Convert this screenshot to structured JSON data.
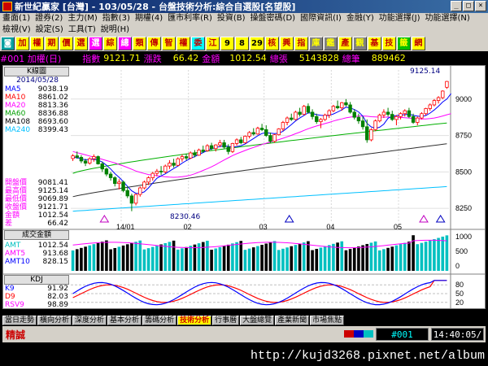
{
  "window": {
    "title": "新世紀贏家 [台灣] - 103/05/28 - 台盤技術分析:綜合自選股[名望股]"
  },
  "menu1": [
    "畫面(1)",
    "證券(2)",
    "主力(M)",
    "指數(3)",
    "期權(4)",
    "匯市利率(R)",
    "投資(B)",
    "操盤密碼(D)",
    "國際資訊(I)",
    "金融(Y)",
    "功能選擇(J)",
    "功能選擇(N)"
  ],
  "menu2": [
    "檢視(V)",
    "設定(S)",
    "工具(T)",
    "說明(H)"
  ],
  "toolbar": [
    {
      "label": "◙",
      "bg": "#00a0a0",
      "fg": "#fff"
    },
    {
      "label": "加",
      "bg": "#ffff00",
      "fg": "#c00000"
    },
    {
      "label": "權",
      "bg": "#ffff00",
      "fg": "#c00000"
    },
    {
      "label": "期",
      "bg": "#ffff00",
      "fg": "#c00000"
    },
    {
      "label": "價",
      "bg": "#ffff00",
      "fg": "#c00000"
    },
    {
      "label": "選",
      "bg": "#ffff00",
      "fg": "#c00000"
    },
    {
      "label": "選",
      "bg": "#ff00ff",
      "fg": "#fff"
    },
    {
      "label": "綜",
      "bg": "#ffff00",
      "fg": "#c00000"
    },
    {
      "label": "總",
      "bg": "#ff00ff",
      "fg": "#fff"
    },
    {
      "label": "類",
      "bg": "#ffff00",
      "fg": "#c00000"
    },
    {
      "label": "傳",
      "bg": "#ffff00",
      "fg": "#c00000"
    },
    {
      "label": "智",
      "bg": "#ffff00",
      "fg": "#c00000"
    },
    {
      "label": "權",
      "bg": "#ffff00",
      "fg": "#c00000"
    },
    {
      "label": "委",
      "bg": "#00ffff",
      "fg": "#c00000"
    },
    {
      "label": "江",
      "bg": "#ffff00",
      "fg": "#c00000"
    },
    {
      "label": "9",
      "bg": "#ffff00",
      "fg": "#000"
    },
    {
      "label": "8",
      "bg": "#ffff00",
      "fg": "#000"
    },
    {
      "label": "29",
      "bg": "#ffff00",
      "fg": "#000"
    },
    {
      "label": "核",
      "bg": "#ffff00",
      "fg": "#c00000"
    },
    {
      "label": "興",
      "bg": "#ffff00",
      "fg": "#c00000"
    },
    {
      "label": "指",
      "bg": "#ffff00",
      "fg": "#c00000"
    },
    {
      "label": "庫",
      "bg": "#808080",
      "fg": "#ff0"
    },
    {
      "label": "鑑",
      "bg": "#808080",
      "fg": "#ff0"
    },
    {
      "label": "產",
      "bg": "#ffff00",
      "fg": "#c00000"
    },
    {
      "label": "觀",
      "bg": "#808080",
      "fg": "#ff0"
    },
    {
      "label": "基",
      "bg": "#ffff00",
      "fg": "#c00000"
    },
    {
      "label": "技",
      "bg": "#ffff00",
      "fg": "#c00000"
    },
    {
      "label": "籤",
      "bg": "#00c000",
      "fg": "#ff0"
    },
    {
      "label": "網",
      "bg": "#ffff00",
      "fg": "#c00000"
    }
  ],
  "infobar": {
    "code_name": "#001 加權(日)",
    "index_label": "指數",
    "index_value": "9121.71",
    "change_label": "漲跌",
    "change_value": "66.42",
    "amount_label": "金額",
    "amount_value": "1012.54",
    "vol_label": "總張",
    "vol_value": "5143828",
    "count_label": "總筆",
    "count_value": "889462"
  },
  "kpanel": {
    "header": "K線圖",
    "date": "2014/05/28",
    "ma": [
      {
        "label": "MA5",
        "value": "9038.19",
        "color": "#ffffff"
      },
      {
        "label": "MA10",
        "value": "8861.02",
        "color": "#ffff00"
      },
      {
        "label": "MA20",
        "value": "8813.36",
        "color": "#ff00ff"
      },
      {
        "label": "MA60",
        "value": "8836.88",
        "color": "#00ff00"
      },
      {
        "label": "MA108",
        "value": "8693.60",
        "color": "#c0c0c0"
      },
      {
        "label": "MA240",
        "value": "8399.43",
        "color": "#00ffff"
      }
    ],
    "ohlc": [
      {
        "label": "開盤價",
        "value": "9081.41"
      },
      {
        "label": "最高價",
        "value": "9125.14"
      },
      {
        "label": "最低價",
        "value": "9069.89"
      },
      {
        "label": "收盤價",
        "value": "9121.71"
      },
      {
        "label": "金額",
        "value": "1012.54"
      },
      {
        "label": "差",
        "value": "66.42"
      }
    ],
    "high_label": "9125.14",
    "low_label": "8230.46",
    "y_ticks": [
      "9000",
      "8750",
      "8500",
      "8250"
    ],
    "x_ticks": [
      "14/01",
      "02",
      "03",
      "04",
      "05"
    ]
  },
  "amtpanel": {
    "header": "成交金額",
    "rows": [
      {
        "label": "AMT",
        "value": "1012.54"
      },
      {
        "label": "AMT5",
        "value": "913.68"
      },
      {
        "label": "AMT10",
        "value": "828.15"
      }
    ],
    "y_ticks": [
      "1000",
      "500",
      "0"
    ]
  },
  "kdjpanel": {
    "header": "KDJ",
    "rows": [
      {
        "label": "K9",
        "value": "91.92"
      },
      {
        "label": "D9",
        "value": "82.03"
      },
      {
        "label": "RSV9",
        "value": "98.89"
      }
    ],
    "y_ticks": [
      "80",
      "50",
      "20"
    ]
  },
  "bottom_tabs": [
    "當日走勢",
    "橫向分析",
    "深度分析",
    "基本分析",
    "籌碼分析",
    "技術分析",
    "行事曆",
    "大盤總覽",
    "產業新聞",
    "市場焦點"
  ],
  "active_tab": 5,
  "status": {
    "left": "精誠",
    "code": "#001",
    "clock": "14:40:05/"
  },
  "url": "http://kujd3268.pixnet.net/album",
  "chart_data": {
    "type": "candlestick",
    "ylim": [
      8150,
      9200
    ],
    "candles": [
      [
        8592,
        8622,
        8575,
        8610
      ],
      [
        8610,
        8640,
        8590,
        8600
      ],
      [
        8600,
        8615,
        8560,
        8575
      ],
      [
        8575,
        8590,
        8540,
        8560
      ],
      [
        8560,
        8600,
        8550,
        8590
      ],
      [
        8590,
        8620,
        8570,
        8605
      ],
      [
        8605,
        8612,
        8550,
        8555
      ],
      [
        8555,
        8570,
        8500,
        8520
      ],
      [
        8520,
        8530,
        8470,
        8485
      ],
      [
        8485,
        8500,
        8440,
        8460
      ],
      [
        8460,
        8470,
        8400,
        8420
      ],
      [
        8420,
        8450,
        8380,
        8430
      ],
      [
        8430,
        8440,
        8360,
        8372
      ],
      [
        8372,
        8400,
        8320,
        8335
      ],
      [
        8335,
        8350,
        8230,
        8285
      ],
      [
        8285,
        8350,
        8270,
        8345
      ],
      [
        8345,
        8400,
        8330,
        8390
      ],
      [
        8390,
        8440,
        8380,
        8430
      ],
      [
        8430,
        8470,
        8410,
        8460
      ],
      [
        8460,
        8500,
        8440,
        8490
      ],
      [
        8490,
        8520,
        8470,
        8505
      ],
      [
        8505,
        8540,
        8480,
        8500
      ],
      [
        8500,
        8550,
        8490,
        8540
      ],
      [
        8540,
        8580,
        8520,
        8560
      ],
      [
        8560,
        8590,
        8530,
        8545
      ],
      [
        8545,
        8600,
        8540,
        8590
      ],
      [
        8590,
        8620,
        8570,
        8605
      ],
      [
        8605,
        8625,
        8580,
        8595
      ],
      [
        8595,
        8640,
        8590,
        8630
      ],
      [
        8630,
        8650,
        8600,
        8615
      ],
      [
        8615,
        8660,
        8610,
        8650
      ],
      [
        8650,
        8680,
        8630,
        8645
      ],
      [
        8645,
        8690,
        8640,
        8680
      ],
      [
        8680,
        8700,
        8650,
        8660
      ],
      [
        8660,
        8690,
        8640,
        8685
      ],
      [
        8685,
        8720,
        8670,
        8700
      ],
      [
        8700,
        8720,
        8660,
        8670
      ],
      [
        8670,
        8690,
        8620,
        8640
      ],
      [
        8640,
        8700,
        8630,
        8695
      ],
      [
        8695,
        8730,
        8680,
        8720
      ],
      [
        8720,
        8740,
        8690,
        8700
      ],
      [
        8700,
        8750,
        8695,
        8745
      ],
      [
        8745,
        8780,
        8730,
        8770
      ],
      [
        8770,
        8800,
        8750,
        8760
      ],
      [
        8760,
        8810,
        8755,
        8800
      ],
      [
        8800,
        8830,
        8780,
        8790
      ],
      [
        8790,
        8820,
        8740,
        8750
      ],
      [
        8750,
        8770,
        8700,
        8710
      ],
      [
        8710,
        8760,
        8700,
        8755
      ],
      [
        8755,
        8800,
        8750,
        8795
      ],
      [
        8795,
        8850,
        8780,
        8840
      ],
      [
        8840,
        8880,
        8820,
        8870
      ],
      [
        8870,
        8900,
        8850,
        8860
      ],
      [
        8860,
        8920,
        8855,
        8910
      ],
      [
        8910,
        8940,
        8880,
        8895
      ],
      [
        8895,
        8960,
        8890,
        8950
      ],
      [
        8950,
        8970,
        8900,
        8910
      ],
      [
        8910,
        8930,
        8860,
        8880
      ],
      [
        8880,
        8900,
        8830,
        8845
      ],
      [
        8845,
        8870,
        8800,
        8860
      ],
      [
        8860,
        8900,
        8850,
        8890
      ],
      [
        8890,
        8930,
        8870,
        8920
      ],
      [
        8920,
        8960,
        8910,
        8950
      ],
      [
        8950,
        8990,
        8930,
        8940
      ],
      [
        8940,
        8980,
        8920,
        8975
      ],
      [
        8975,
        9000,
        8950,
        8960
      ],
      [
        8960,
        8980,
        8900,
        8910
      ],
      [
        8910,
        8930,
        8860,
        8875
      ],
      [
        8875,
        8900,
        8830,
        8850
      ],
      [
        8850,
        8880,
        8790,
        8810
      ],
      [
        8810,
        8860,
        8700,
        8720
      ],
      [
        8720,
        8800,
        8710,
        8790
      ],
      [
        8790,
        8860,
        8780,
        8850
      ],
      [
        8850,
        8900,
        8840,
        8890
      ],
      [
        8890,
        8930,
        8870,
        8910
      ],
      [
        8910,
        8940,
        8880,
        8895
      ],
      [
        8895,
        8920,
        8850,
        8860
      ],
      [
        8860,
        8890,
        8820,
        8880
      ],
      [
        8880,
        8910,
        8860,
        8900
      ],
      [
        8900,
        8930,
        8880,
        8920
      ],
      [
        8920,
        8940,
        8870,
        8880
      ],
      [
        8880,
        8900,
        8830,
        8840
      ],
      [
        8840,
        8880,
        8820,
        8870
      ],
      [
        8870,
        8910,
        8860,
        8900
      ],
      [
        8900,
        8940,
        8890,
        8935
      ],
      [
        8935,
        8970,
        8920,
        8960
      ],
      [
        8960,
        9000,
        8950,
        8990
      ],
      [
        8990,
        9020,
        8970,
        9010
      ],
      [
        9010,
        9060,
        9000,
        9055
      ],
      [
        9081,
        9125,
        9070,
        9121
      ]
    ],
    "ma5": [
      8600,
      8597,
      8590,
      8583,
      8587,
      8586,
      8580,
      8568,
      8546,
      8520,
      8488,
      8463,
      8433,
      8400,
      8370,
      8353,
      8353,
      8363,
      8390,
      8424,
      8456,
      8473,
      8487,
      8505,
      8523,
      8540,
      8560,
      8577,
      8593,
      8605,
      8619,
      8633,
      8647,
      8658,
      8667,
      8674,
      8679,
      8675,
      8670,
      8674,
      8680,
      8692,
      8711,
      8729,
      8748,
      8764,
      8768,
      8766,
      8763,
      8766,
      8779,
      8802,
      8825,
      8850,
      8870,
      8888,
      8906,
      8902,
      8893,
      8889,
      8886,
      8888,
      8898,
      8911,
      8926,
      8945,
      8939,
      8928,
      8912,
      8883,
      8833,
      8809,
      8799,
      8807,
      8828,
      8868,
      8881,
      8887,
      8890,
      8893,
      8897,
      8888,
      8883,
      8880,
      8887,
      8904,
      8925,
      8951,
      8980,
      9000,
      9038
    ],
    "ma20": [
      8640,
      8632,
      8625,
      8617,
      8609,
      8602,
      8594,
      8586,
      8578,
      8570,
      8561,
      8551,
      8541,
      8530,
      8518,
      8506,
      8497,
      8489,
      8482,
      8478,
      8474,
      8470,
      8466,
      8464,
      8463,
      8464,
      8467,
      8471,
      8478,
      8487,
      8498,
      8510,
      8522,
      8535,
      8550,
      8566,
      8582,
      8597,
      8612,
      8625,
      8636,
      8647,
      8658,
      8668,
      8678,
      8688,
      8697,
      8705,
      8714,
      8722,
      8731,
      8741,
      8751,
      8762,
      8773,
      8785,
      8796,
      8806,
      8815,
      8823,
      8832,
      8840,
      8849,
      8857,
      8864,
      8871,
      8876,
      8880,
      8883,
      8884,
      8882,
      8879,
      8877,
      8876,
      8876,
      8876,
      8876,
      8875,
      8874,
      8872,
      8870,
      8867,
      8865,
      8864,
      8864,
      8866,
      8870,
      8876,
      8884,
      8892,
      8900
    ]
  }
}
